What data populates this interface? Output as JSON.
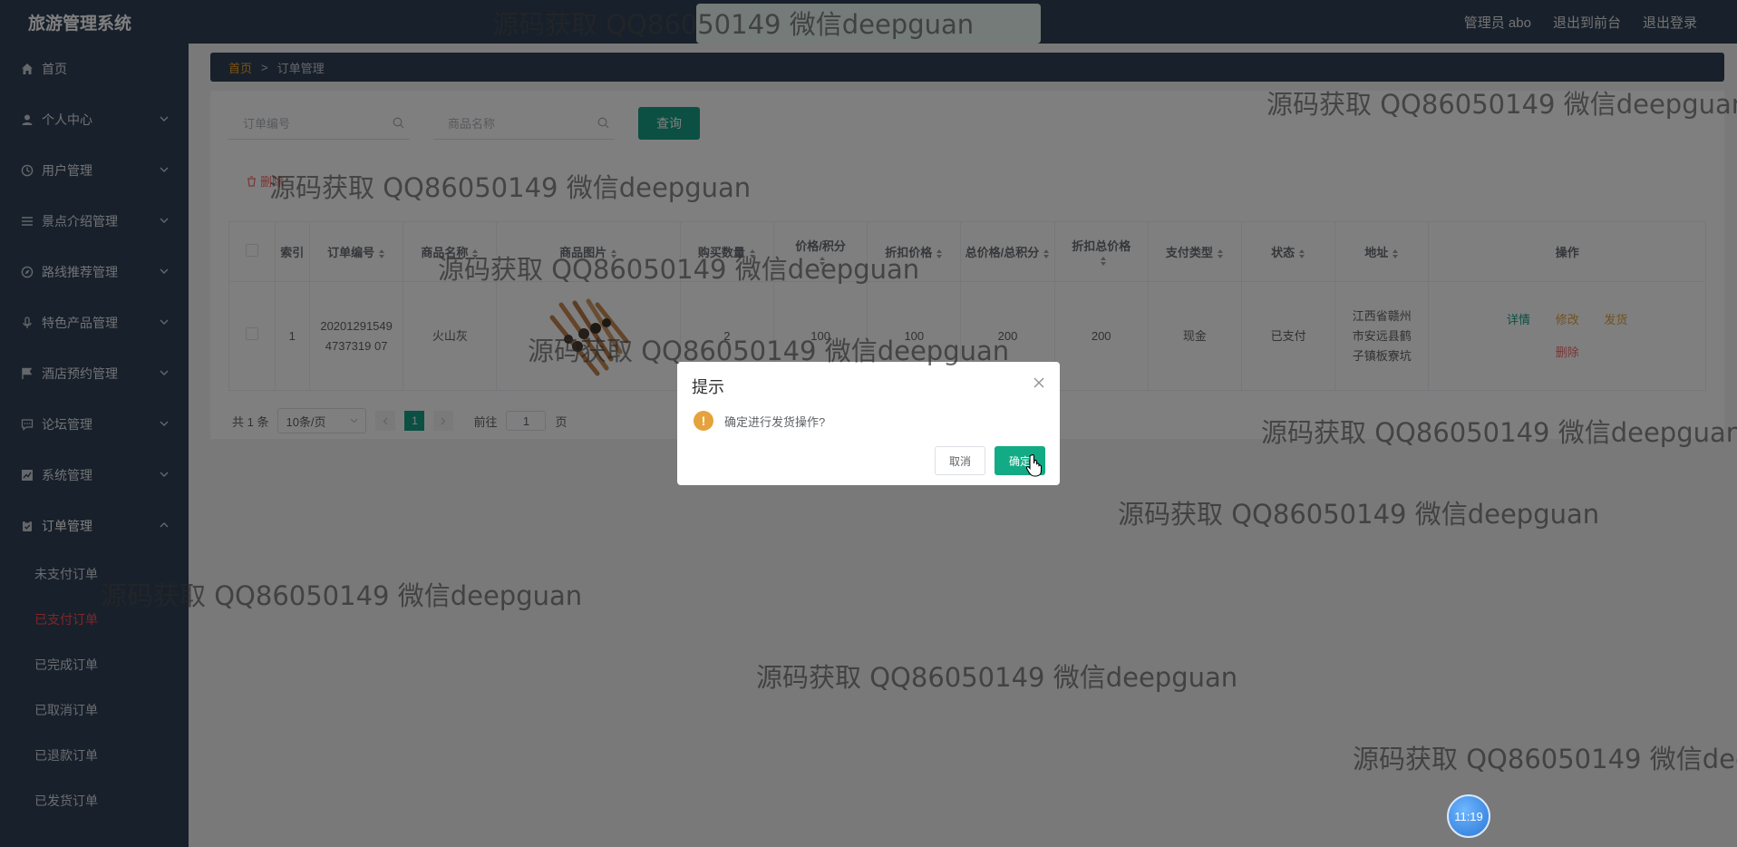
{
  "header": {
    "title": "旅游管理系统",
    "user": "管理员 abo",
    "front": "退出到前台",
    "logout": "退出登录"
  },
  "sidebar": {
    "items": [
      {
        "label": "首页"
      },
      {
        "label": "个人中心"
      },
      {
        "label": "用户管理"
      },
      {
        "label": "景点介绍管理"
      },
      {
        "label": "路线推荐管理"
      },
      {
        "label": "特色产品管理"
      },
      {
        "label": "酒店预约管理"
      },
      {
        "label": "论坛管理"
      },
      {
        "label": "系统管理"
      },
      {
        "label": "订单管理"
      }
    ],
    "sub": [
      {
        "label": "未支付订单"
      },
      {
        "label": "已支付订单"
      },
      {
        "label": "已完成订单"
      },
      {
        "label": "已取消订单"
      },
      {
        "label": "已退款订单"
      },
      {
        "label": "已发货订单"
      }
    ]
  },
  "breadcrumb": {
    "home": "首页",
    "sep": ">",
    "current": "订单管理"
  },
  "search": {
    "order_placeholder": "订单编号",
    "product_placeholder": "商品名称",
    "query": "查询"
  },
  "delete_label": "删除",
  "table": {
    "headers": [
      "索引",
      "订单编号",
      "商品名称",
      "商品图片",
      "购买数量",
      "价格/积分",
      "折扣价格",
      "总价格/总积分",
      "折扣总价格",
      "支付类型",
      "状态",
      "地址",
      "操作"
    ],
    "row": {
      "index": "1",
      "order_no": "202012915494737319 07",
      "product": "火山灰",
      "qty": "2",
      "price": "100",
      "discount": "100",
      "total": "200",
      "discount_total": "200",
      "pay_type": "现金",
      "status": "已支付",
      "address": "江西省赣州市安远县鹤子镇板寮坑",
      "op_detail": "详情",
      "op_edit": "修改",
      "op_ship": "发货",
      "op_delete": "删除"
    }
  },
  "pager": {
    "total": "共 1 条",
    "size": "10条/页",
    "current": "1",
    "goto": "前往",
    "page_value": "1",
    "page_unit": "页"
  },
  "dialog": {
    "title": "提示",
    "message": "确定进行发货操作?",
    "cancel": "取消",
    "ok": "确定"
  },
  "watermark": "源码获取 QQ86050149 微信deepguan",
  "clock": "11:19",
  "colors": {
    "sidebar": "#304156",
    "accent": "#16a085",
    "danger": "#f56c6c",
    "warning": "#e6a23c"
  }
}
